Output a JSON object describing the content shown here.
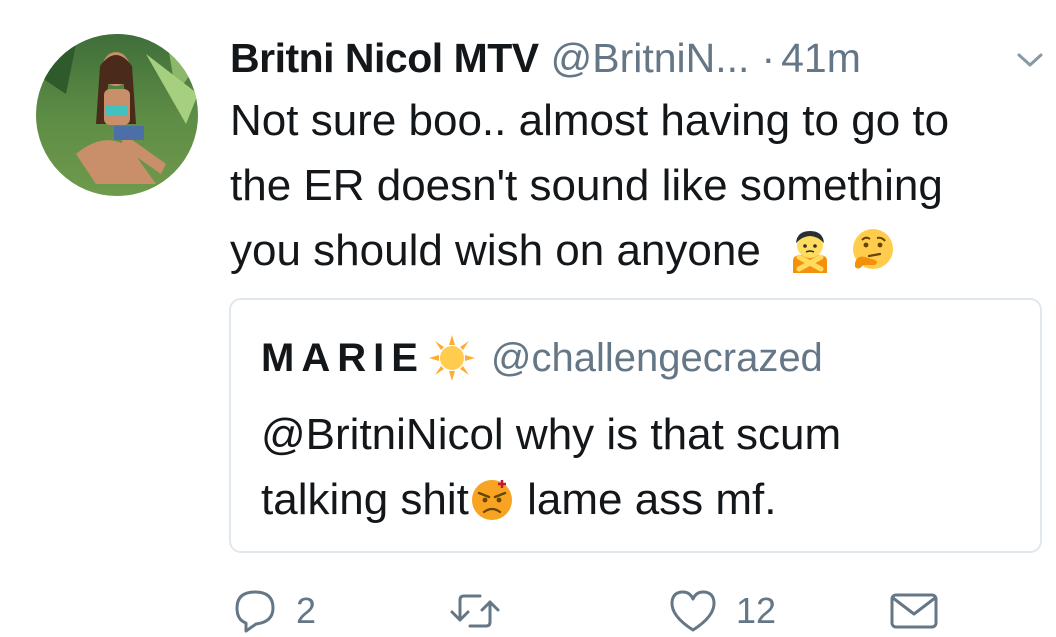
{
  "tweet": {
    "display_name": "Britni Nicol MTV",
    "handle": "@BritniN...",
    "separator": "·",
    "time": "41m",
    "text_line1": "Not sure boo.. almost having to go to",
    "text_line2": "the ER doesn't sound like something",
    "text_line3": "you should wish on anyone"
  },
  "quoted": {
    "name": "MARIE",
    "handle": "@challengecrazed",
    "text_line1": "@BritniNicol why is that scum",
    "text_line2_before": "talking shit",
    "text_line2_after": " lame ass mf."
  },
  "actions": {
    "reply_count": "2",
    "like_count": "12"
  },
  "colors": {
    "text": "#14171a",
    "secondary": "#657786",
    "border": "#e1e8ed"
  },
  "icons": [
    "avatar",
    "chevron-down-icon",
    "woman-gesturing-no-emoji",
    "thinking-face-emoji",
    "sun-emoji",
    "angry-face-emoji",
    "reply-icon",
    "retweet-icon",
    "like-icon",
    "direct-message-icon"
  ]
}
